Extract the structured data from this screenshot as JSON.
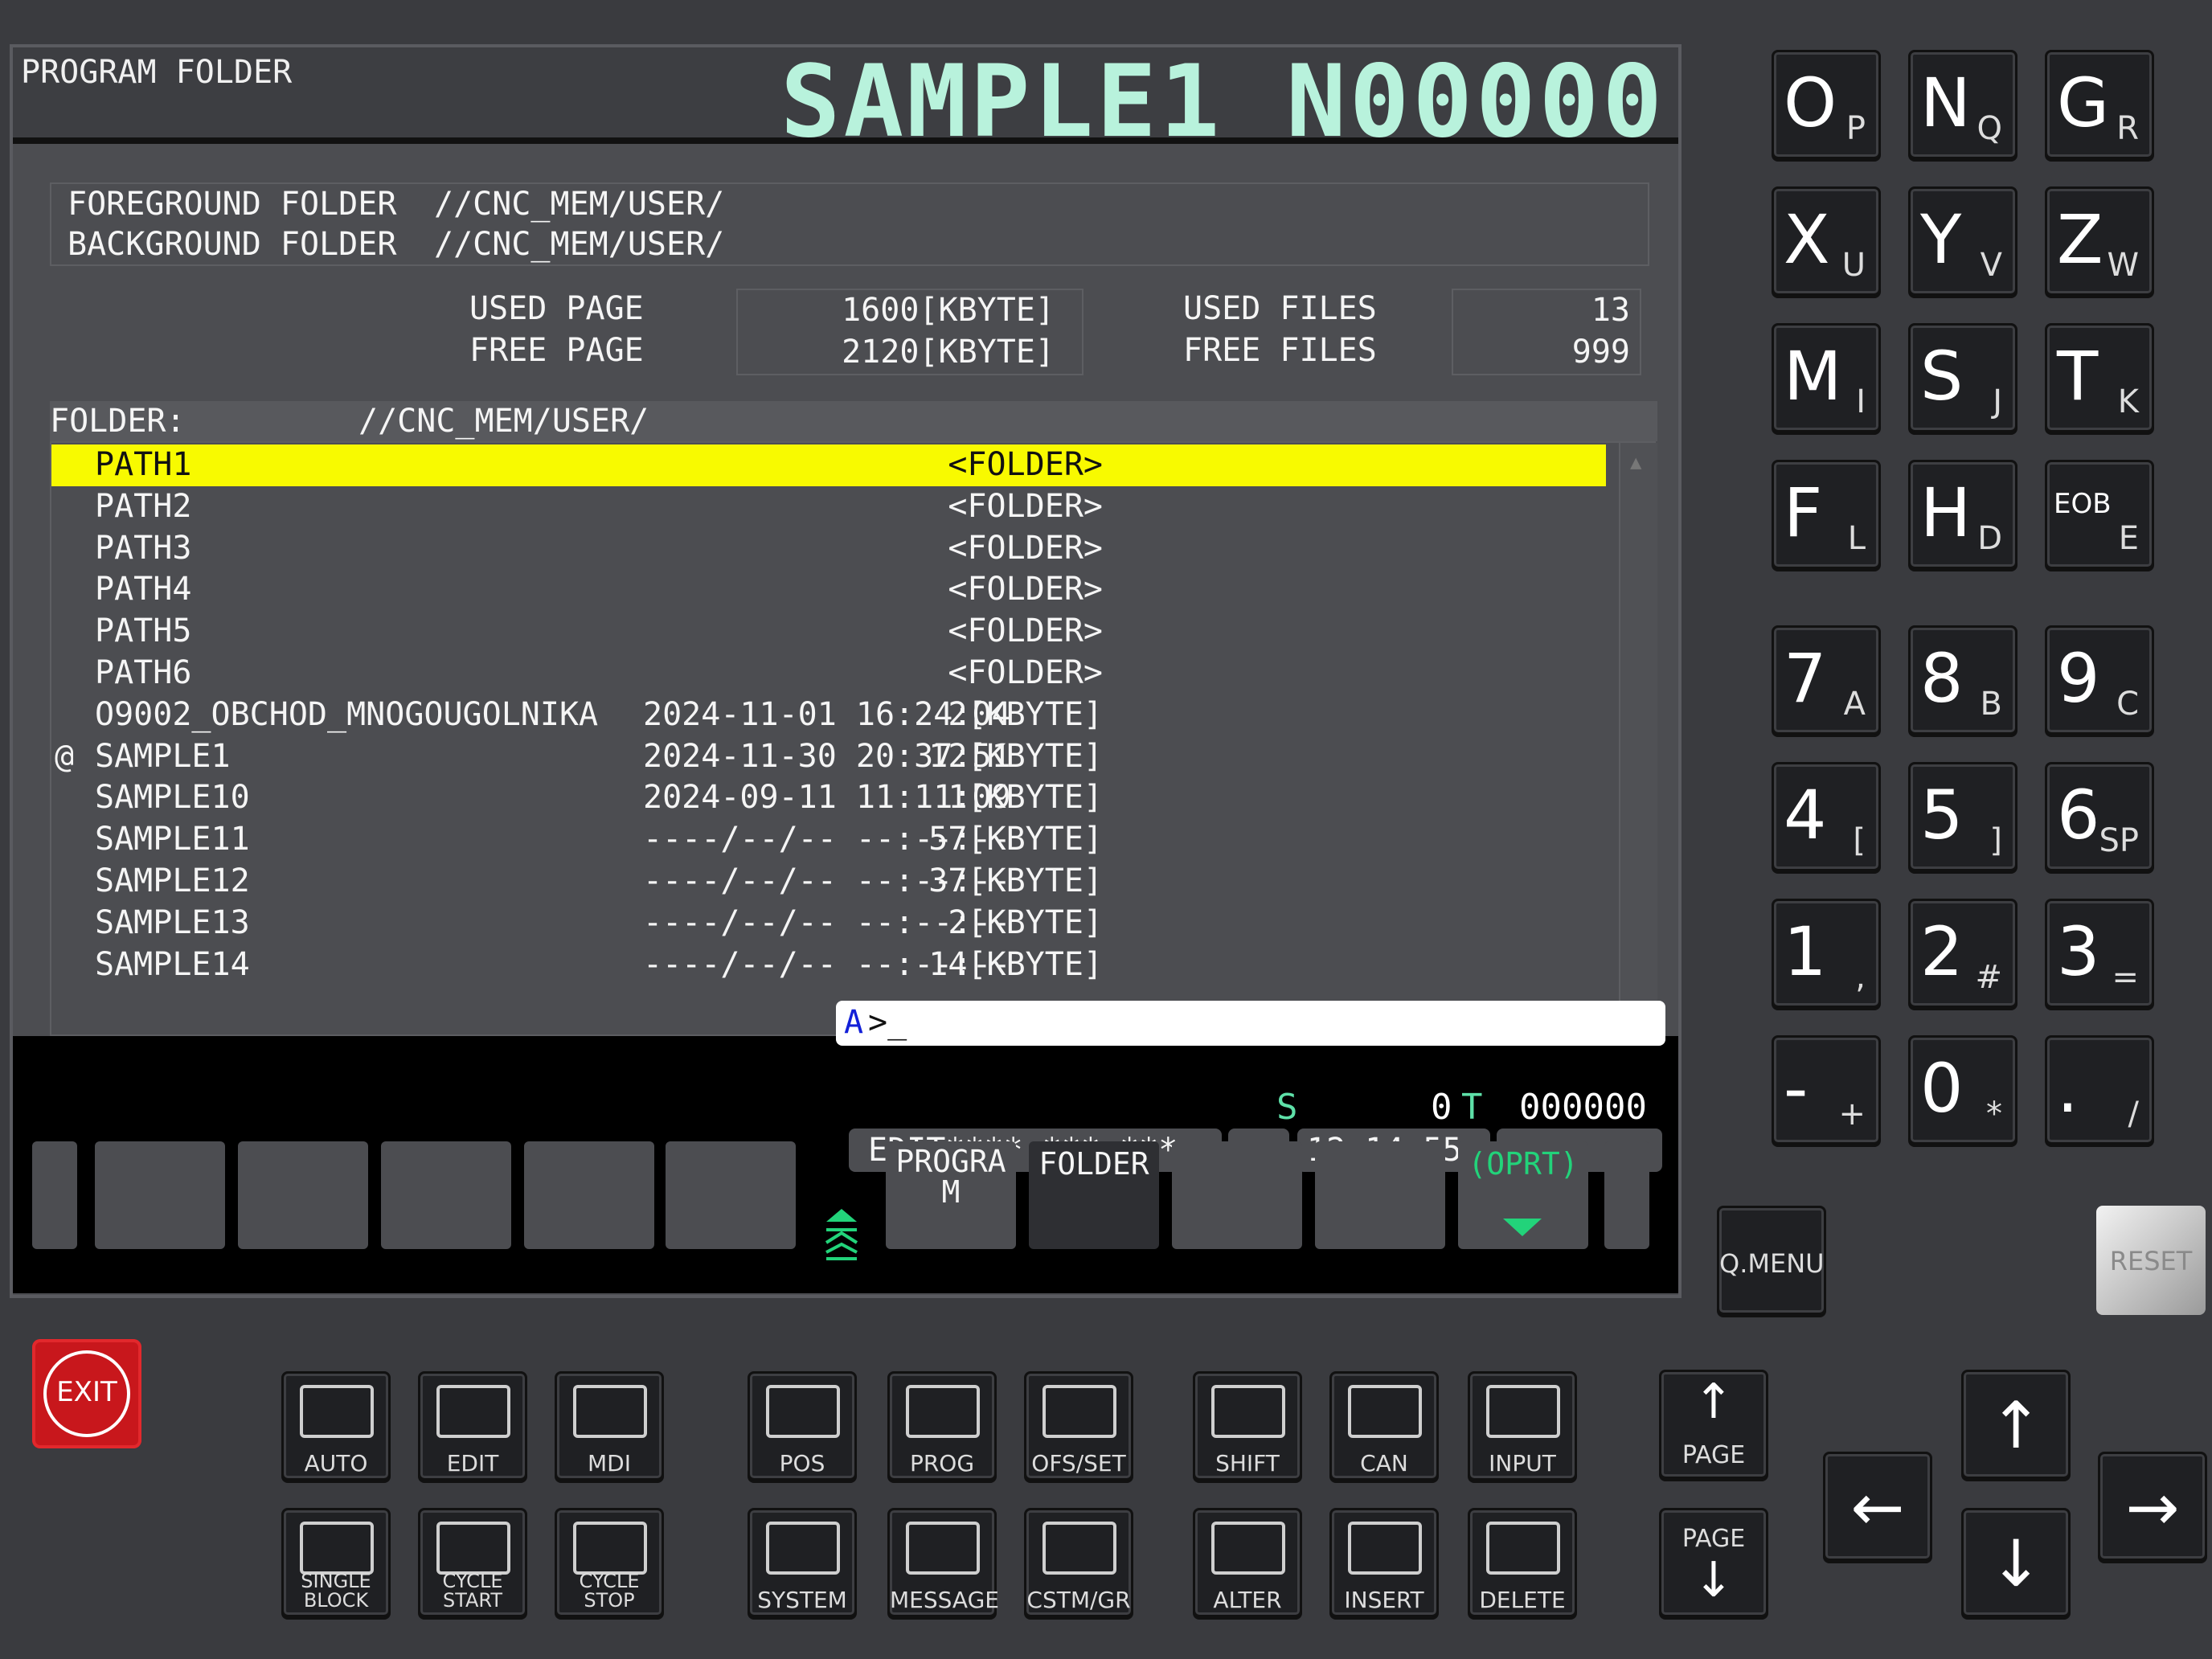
{
  "title": {
    "left": "PROGRAM FOLDER",
    "right": "SAMPLE1 N00000"
  },
  "folders": {
    "foreground_label": "FOREGROUND FOLDER",
    "foreground_path": "//CNC_MEM/USER/",
    "background_label": "BACKGROUND FOLDER",
    "background_path": "//CNC_MEM/USER/"
  },
  "usage": {
    "used_page_label": "USED PAGE",
    "used_page_value": "1600[KBYTE]",
    "free_page_label": "FREE PAGE",
    "free_page_value": "2120[KBYTE]",
    "used_files_label": "USED FILES",
    "used_files_value": "13",
    "free_files_label": "FREE FILES",
    "free_files_value": "999"
  },
  "list": {
    "header_label": "FOLDER:",
    "header_path": "//CNC_MEM/USER/",
    "rows": [
      {
        "mark": "",
        "name": "PATH1",
        "size": "<FOLDER>",
        "date": ""
      },
      {
        "mark": "",
        "name": "PATH2",
        "size": "<FOLDER>",
        "date": ""
      },
      {
        "mark": "",
        "name": "PATH3",
        "size": "<FOLDER>",
        "date": ""
      },
      {
        "mark": "",
        "name": "PATH4",
        "size": "<FOLDER>",
        "date": ""
      },
      {
        "mark": "",
        "name": "PATH5",
        "size": "<FOLDER>",
        "date": ""
      },
      {
        "mark": "",
        "name": "PATH6",
        "size": "<FOLDER>",
        "date": ""
      },
      {
        "mark": "",
        "name": "O9002_OBCHOD_MNOGOUGOLNIKA",
        "size": "2[KBYTE]",
        "date": "2024-11-01 16:24:04"
      },
      {
        "mark": "@",
        "name": "SAMPLE1",
        "size": "12[KBYTE]",
        "date": "2024-11-30 20:37:51"
      },
      {
        "mark": "",
        "name": "SAMPLE10",
        "size": "1[KBYTE]",
        "date": "2024-09-11 11:11:09"
      },
      {
        "mark": "",
        "name": "SAMPLE11",
        "size": "57[KBYTE]",
        "date": "----/--/-- --:--:--"
      },
      {
        "mark": "",
        "name": "SAMPLE12",
        "size": "37[KBYTE]",
        "date": "----/--/-- --:--:--"
      },
      {
        "mark": "",
        "name": "SAMPLE13",
        "size": "2[KBYTE]",
        "date": "----/--/-- --:--:--"
      },
      {
        "mark": "",
        "name": "SAMPLE14",
        "size": "14[KBYTE]",
        "date": "----/--/-- --:--:--"
      }
    ]
  },
  "input": {
    "prompt_letter": "A",
    "prompt": ">_"
  },
  "status": {
    "s_label": "S",
    "s_value": "0",
    "t_label": "T",
    "t_value": "000000",
    "mode": "EDIT**** *** ***",
    "time": "12:14:55"
  },
  "softkeys": {
    "program": "PROGRA\nM",
    "folder": "FOLDER",
    "oprt": "(OPRT)"
  },
  "colors": {
    "title_accent": "#b8f2dc",
    "selection": "#f8fa00",
    "softkey_accent": "#22d37a",
    "exit_red": "#c8171c"
  },
  "keypad": [
    {
      "main": "O",
      "sub": "P"
    },
    {
      "main": "N",
      "sub": "Q"
    },
    {
      "main": "G",
      "sub": "R"
    },
    {
      "main": "X",
      "sub": "U"
    },
    {
      "main": "Y",
      "sub": "V"
    },
    {
      "main": "Z",
      "sub": "W"
    },
    {
      "main": "M",
      "sub": "I"
    },
    {
      "main": "S",
      "sub": "J"
    },
    {
      "main": "T",
      "sub": "K"
    },
    {
      "main": "F",
      "sub": "L"
    },
    {
      "main": "H",
      "sub": "D"
    },
    {
      "main": "EOB",
      "sub": "E"
    },
    {
      "main": "7",
      "sub": "A"
    },
    {
      "main": "8",
      "sub": "B"
    },
    {
      "main": "9",
      "sub": "C"
    },
    {
      "main": "4",
      "sub": "["
    },
    {
      "main": "5",
      "sub": "]"
    },
    {
      "main": "6",
      "sub": "SP"
    },
    {
      "main": "1",
      "sub": ","
    },
    {
      "main": "2",
      "sub": "#"
    },
    {
      "main": "3",
      "sub": "="
    },
    {
      "main": "-",
      "sub": "+"
    },
    {
      "main": "0",
      "sub": "*"
    },
    {
      "main": ".",
      "sub": "/"
    }
  ],
  "buttons": {
    "qmenu": "Q.MENU",
    "reset": "RESET",
    "exit": "EXIT",
    "auto": "AUTO",
    "edit": "EDIT",
    "mdi": "MDI",
    "single_block": "SINGLE\nBLOCK",
    "cycle_start": "CYCLE\nSTART",
    "cycle_stop": "CYCLE\nSTOP",
    "pos": "POS",
    "prog": "PROG",
    "ofs_set": "OFS/SET",
    "system": "SYSTEM",
    "message": "MESSAGE",
    "cstm_gr": "CSTM/GR",
    "shift": "SHIFT",
    "can": "CAN",
    "input": "INPUT",
    "alter": "ALTER",
    "insert": "INSERT",
    "delete": "DELETE",
    "page_up": "PAGE",
    "page_down": "PAGE"
  }
}
